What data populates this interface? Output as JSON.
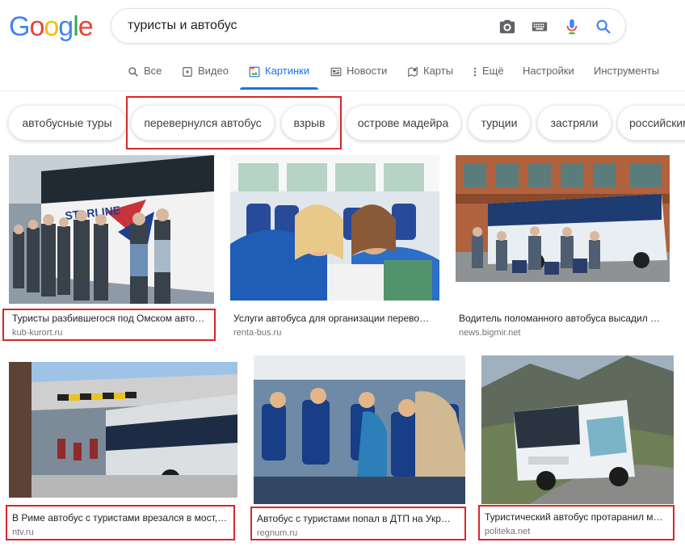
{
  "logo": {
    "letters": [
      "G",
      "o",
      "o",
      "g",
      "l",
      "e"
    ],
    "colors": [
      "#4285F4",
      "#EA4335",
      "#FBBC05",
      "#4285F4",
      "#34A853",
      "#EA4335"
    ]
  },
  "search": {
    "query": "туристы и автобус"
  },
  "tabs": [
    {
      "label": "Все",
      "icon": "search-icon"
    },
    {
      "label": "Видео",
      "icon": "video-icon"
    },
    {
      "label": "Картинки",
      "icon": "images-icon",
      "active": true
    },
    {
      "label": "Новости",
      "icon": "news-icon"
    },
    {
      "label": "Карты",
      "icon": "maps-icon"
    },
    {
      "label": "Ещё",
      "icon": "more-vert-icon"
    },
    {
      "label": "Настройки"
    },
    {
      "label": "Инструменты"
    }
  ],
  "chips": [
    "автобусные туры",
    "перевернулся автобус",
    "взрыв",
    "острове мадейра",
    "турции",
    "застряли",
    "российским"
  ],
  "results": [
    {
      "title": "Туристы разбившегося под Омском авто…",
      "site": "kub-kurort.ru"
    },
    {
      "title": "Услуги автобуса для организации перево…",
      "site": "renta-bus.ru"
    },
    {
      "title": "Водитель поломанного автобуса высадил …",
      "site": "news.bigmir.net"
    },
    {
      "title": "В Риме автобус с туристами врезался в мост,…",
      "site": "ntv.ru"
    },
    {
      "title": "Автобус с туристами попал в ДТП на Укр…",
      "site": "regnum.ru"
    },
    {
      "title": "Туристический автобус протаранил м…",
      "site": "politeka.net"
    }
  ],
  "colors": {
    "accent": "#1a73e8",
    "highlight": "#d9262a"
  }
}
